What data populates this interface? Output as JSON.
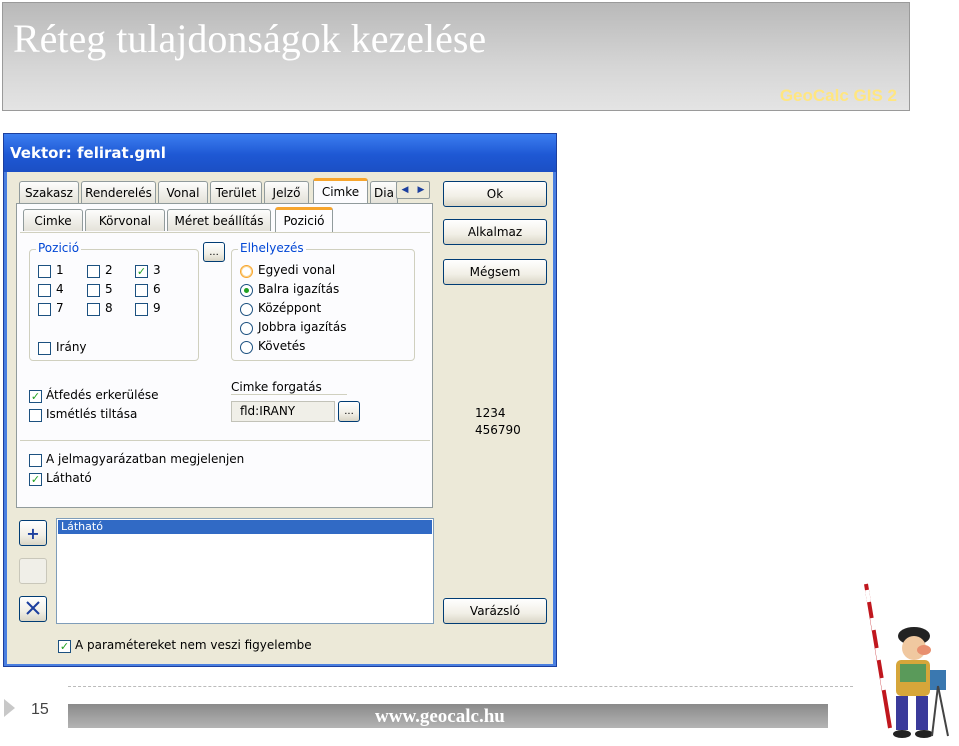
{
  "slide": {
    "title": "Réteg tulajdonságok kezelése",
    "brand": "GeoCalc GIS 2",
    "page_number": "15",
    "footer_url": "www.geocalc.hu"
  },
  "dialog": {
    "title": "Vektor: felirat.gml",
    "main_tabs": [
      "Szakasz",
      "Renderelés",
      "Vonal",
      "Terület",
      "Jelző",
      "Cimke",
      "Dia"
    ],
    "active_main_tab": "Cimke",
    "sub_tabs": [
      "Cimke",
      "Körvonal",
      "Méret beállítás",
      "Pozició"
    ],
    "active_sub_tab": "Pozició",
    "position_group": {
      "legend": "Pozició",
      "checkboxes": [
        {
          "label": "1",
          "checked": false
        },
        {
          "label": "2",
          "checked": false
        },
        {
          "label": "3",
          "checked": true
        },
        {
          "label": "4",
          "checked": false
        },
        {
          "label": "5",
          "checked": false
        },
        {
          "label": "6",
          "checked": false
        },
        {
          "label": "7",
          "checked": false
        },
        {
          "label": "8",
          "checked": false
        },
        {
          "label": "9",
          "checked": false
        }
      ],
      "direction_label": "Irány",
      "ellipsis": "..."
    },
    "placement_group": {
      "legend": "Elhelyezés",
      "options": [
        "Egyedi vonal",
        "Balra igazítás",
        "Középpont",
        "Jobbra igazítás",
        "Követés"
      ],
      "selected": "Balra igazítás"
    },
    "overlap_label": "Átfedés erkerülése",
    "no_repeat_label": "Ismétlés tiltása",
    "rotation": {
      "legend": "Cimke forgatás",
      "value": "fld:IRANY",
      "ellipsis": "..."
    },
    "legend_show_label": "A jelmagyarázatban megjelenjen",
    "visible_label": "Látható",
    "buttons": {
      "ok": "Ok",
      "apply": "Alkalmaz",
      "cancel": "Mégsem",
      "wizard": "Varázsló",
      "add": "+"
    },
    "preview_lines": [
      "1234",
      "456790"
    ],
    "list_items": [
      "Látható"
    ],
    "ignore_params_label": "A paramétereket nem veszi figyelembe"
  }
}
